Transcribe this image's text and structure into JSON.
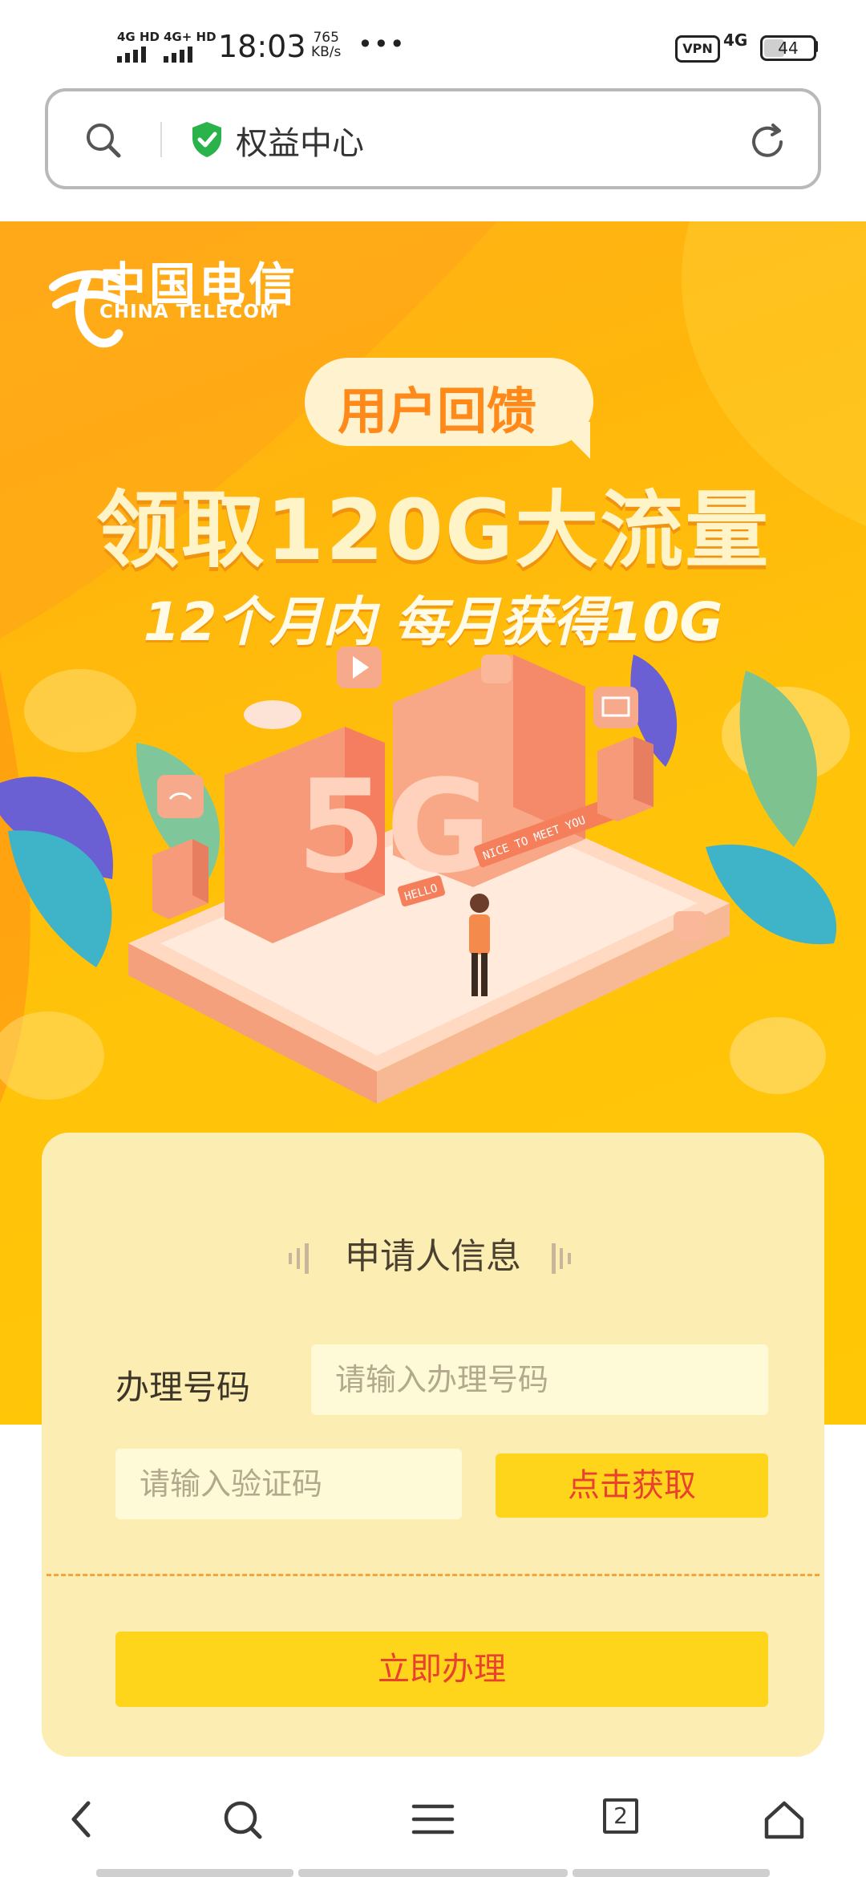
{
  "status_bar": {
    "signal1": "4G HD",
    "signal2": "4G+ HD",
    "time": "18:03",
    "speed_value": "765",
    "speed_unit": "KB/s",
    "more": "•••",
    "vpn": "VPN",
    "network": "4G",
    "battery": "44",
    "battery_level": 0.44
  },
  "address_bar": {
    "title": "权益中心",
    "secure_color": "#2bb34b"
  },
  "banner": {
    "logo_cn": "中国电信",
    "logo_en": "CHINA TELECOM",
    "bubble": "用户回馈",
    "headline": "领取120G大流量",
    "subline": "12个月内 每月获得10G",
    "illustration": {
      "badge_5g": "5G",
      "tag_hello": "HELLO",
      "tag_nice": "NICE TO MEET YOU"
    }
  },
  "form": {
    "section_title": "申请人信息",
    "phone_label": "办理号码",
    "phone_placeholder": "请输入办理号码",
    "code_placeholder": "请输入验证码",
    "get_code_button": "点击获取",
    "submit_button": "立即办理"
  },
  "bottom_nav": {
    "tab_count": "2"
  },
  "colors": {
    "banner_orange": "#ffb11a",
    "card_bg": "#fcedb3",
    "button_yellow": "#ffd51c",
    "button_text": "#e8412f"
  }
}
